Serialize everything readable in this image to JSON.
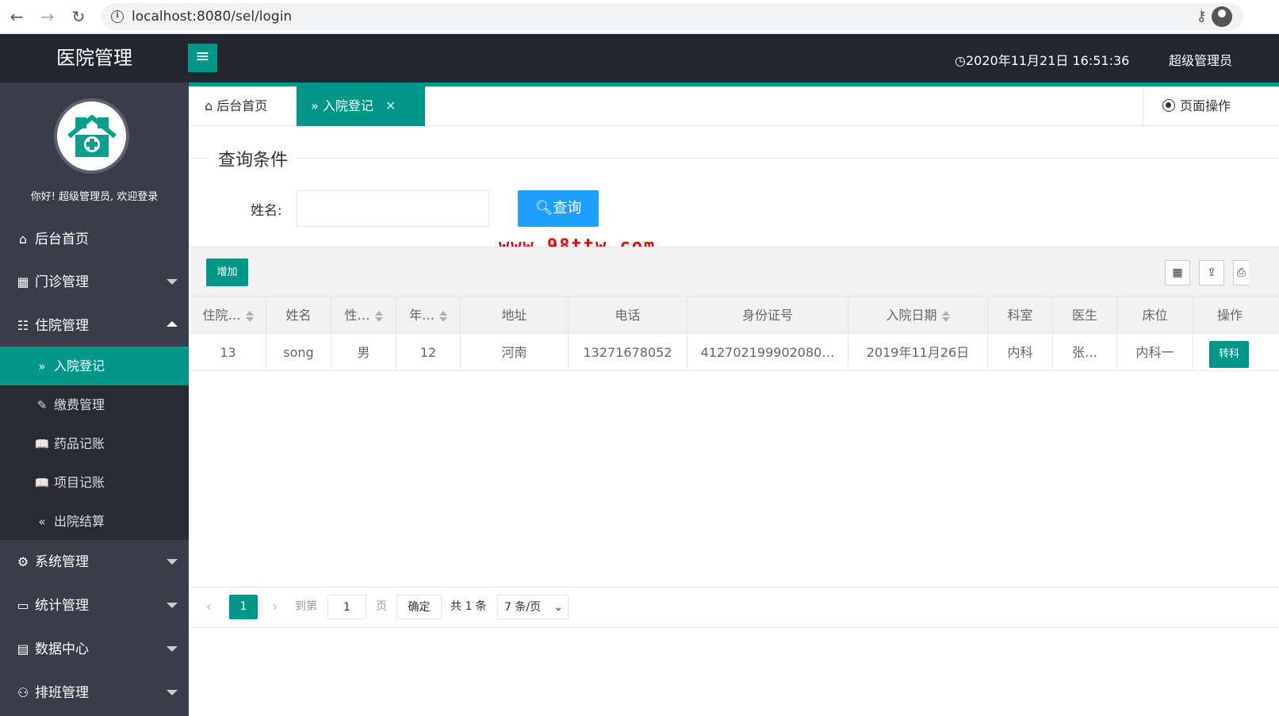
{
  "browser": {
    "url": "localhost:8080/sel/login"
  },
  "header": {
    "app_title": "医院管理",
    "datetime": "2020年11月21日 16:51:36",
    "user_label": "超级管理员"
  },
  "sidebar": {
    "welcome": "你好! 超级管理员, 欢迎登录",
    "items": [
      {
        "label": "后台首页",
        "icon": "home-icon"
      },
      {
        "label": "门诊管理",
        "icon": "grid-icon"
      },
      {
        "label": "住院管理",
        "icon": "list-icon",
        "expanded": true
      },
      {
        "label": "系统管理",
        "icon": "gear-icon"
      },
      {
        "label": "统计管理",
        "icon": "monitor-icon"
      },
      {
        "label": "数据中心",
        "icon": "document-icon"
      },
      {
        "label": "排班管理",
        "icon": "user-icon"
      }
    ],
    "sub_items": [
      {
        "label": "入院登记",
        "icon": "double-chevron-right-icon",
        "active": true
      },
      {
        "label": "缴费管理",
        "icon": "edit-icon"
      },
      {
        "label": "药品记账",
        "icon": "book-icon"
      },
      {
        "label": "项目记账",
        "icon": "book-icon"
      },
      {
        "label": "出院结算",
        "icon": "double-chevron-left-icon"
      }
    ]
  },
  "tabs": {
    "home": "后台首页",
    "active": "入院登记",
    "page_ops": "页面操作"
  },
  "search": {
    "legend": "查询条件",
    "name_label": "姓名:",
    "name_value": "",
    "button": "查询"
  },
  "watermark": "www.98ttw.com",
  "toolbar": {
    "add": "增加"
  },
  "table": {
    "headers": [
      "住院…",
      "姓名",
      "性…",
      "年…",
      "地址",
      "电话",
      "身份证号",
      "入院日期",
      "科室",
      "医生",
      "床位",
      "操作"
    ],
    "rows": [
      [
        "13",
        "song",
        "男",
        "12",
        "河南",
        "13271678052",
        "412702199902080…",
        "2019年11月26日",
        "内科",
        "张…",
        "内科一",
        "转科"
      ]
    ]
  },
  "pagination": {
    "current_page": "1",
    "goto_label": "到第",
    "goto_value": "1",
    "page_unit": "页",
    "confirm": "确定",
    "total": "共 1 条",
    "page_size": "7 条/页"
  },
  "colors": {
    "accent": "#009688",
    "header_bg": "#23262e",
    "sidebar_bg": "#393d49",
    "search_button": "#1e9fff",
    "watermark": "#ee0000"
  }
}
